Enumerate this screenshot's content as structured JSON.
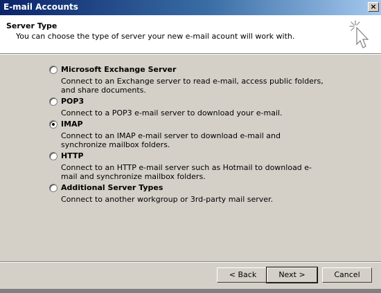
{
  "window": {
    "title": "E-mail Accounts",
    "close_glyph": "×"
  },
  "header": {
    "title": "Server Type",
    "subtitle": "You can choose the type of server your new e-mail acount will work with.",
    "icon": "wizard-cursor-icon"
  },
  "options": [
    {
      "label": "Microsoft Exchange Server",
      "description": "Connect to an Exchange server to read e-mail, access public folders, and share documents.",
      "selected": false
    },
    {
      "label": "POP3",
      "description": "Connect to a POP3 e-mail server to download your e-mail.",
      "selected": false
    },
    {
      "label": "IMAP",
      "description": "Connect to an IMAP e-mail server to download e-mail and synchronize mailbox folders.",
      "selected": true
    },
    {
      "label": "HTTP",
      "description": "Connect to an HTTP e-mail server such as Hotmail to download e-mail and synchronize mailbox folders.",
      "selected": false
    },
    {
      "label": "Additional Server Types",
      "description": "Connect to another workgroup or 3rd-party mail server.",
      "selected": false
    }
  ],
  "buttons": {
    "back": "< Back",
    "next": "Next >",
    "cancel": "Cancel"
  }
}
